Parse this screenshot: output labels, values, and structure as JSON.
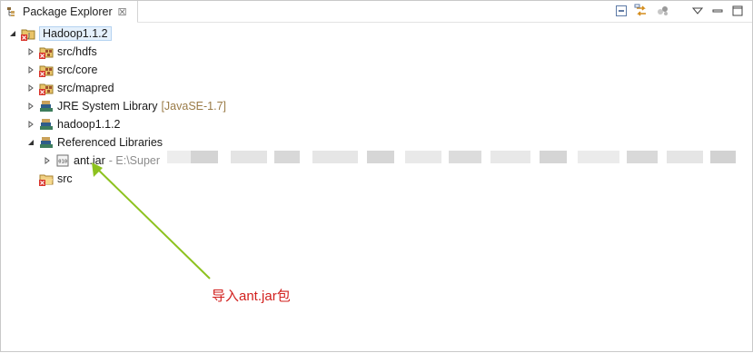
{
  "panel": {
    "title": "Package Explorer",
    "close": "☒"
  },
  "toolbar": {
    "icons": [
      "collapse-all-icon",
      "link-with-editor-icon",
      "view-menu-icon",
      "minimize-icon",
      "maximize-icon"
    ]
  },
  "tree": {
    "project": "Hadoop1.1.2",
    "items": [
      {
        "label": "src/hdfs"
      },
      {
        "label": "src/core"
      },
      {
        "label": "src/mapred"
      },
      {
        "label": "JRE System Library",
        "decoration": "[JavaSE-1.7]"
      },
      {
        "label": "hadoop1.1.2"
      },
      {
        "label": "Referenced Libraries"
      },
      {
        "label": "ant.jar",
        "decoration": "- E:\\Super"
      },
      {
        "label": "src"
      }
    ]
  },
  "annotation": {
    "text": "导入ant.jar包",
    "color": "#d2201e",
    "arrow_color": "#8dc21f"
  }
}
